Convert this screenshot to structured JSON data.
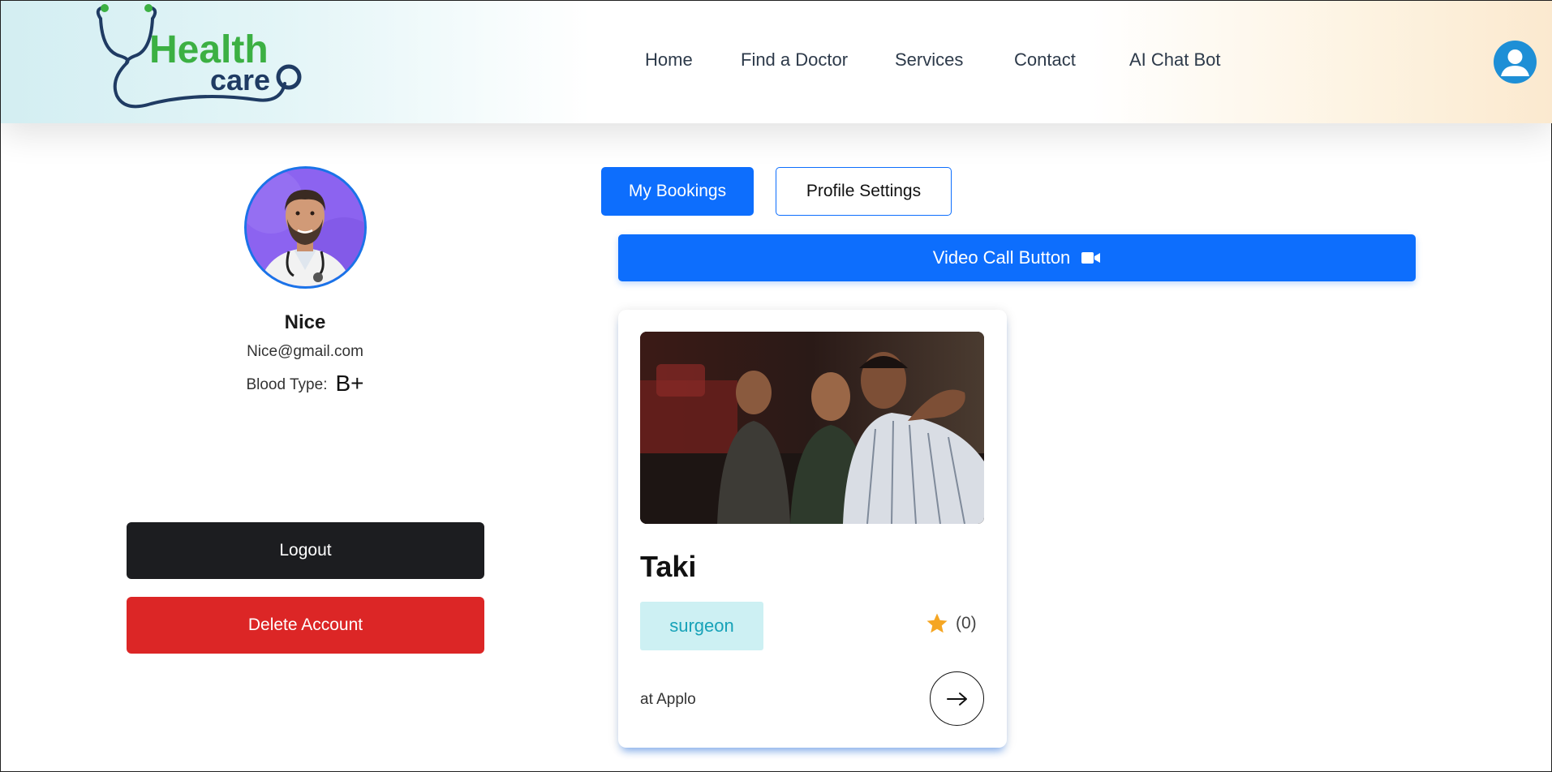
{
  "header": {
    "logo_text_top": "Health",
    "logo_text_bottom": "care",
    "nav": [
      {
        "label": "Home"
      },
      {
        "label": "Find a Doctor"
      },
      {
        "label": "Services"
      },
      {
        "label": "Contact"
      },
      {
        "label": "AI Chat Bot"
      }
    ],
    "account_icon": "user-circle-icon"
  },
  "profile": {
    "name": "Nice",
    "email": "Nice@gmail.com",
    "blood_type_label": "Blood Type:",
    "blood_type_value": "B+",
    "photo_icon": "doctor-avatar"
  },
  "actions": {
    "logout_label": "Logout",
    "delete_label": "Delete Account"
  },
  "tabs": {
    "bookings_label": "My Bookings",
    "settings_label": "Profile Settings"
  },
  "video_call": {
    "label": "Video Call Button",
    "icon": "video-camera-icon"
  },
  "booking_card": {
    "doctor_name": "Taki",
    "specialty": "surgeon",
    "rating_count": "(0)",
    "hospital": "at Applo",
    "icons": [
      "star-icon",
      "arrow-right-icon"
    ]
  },
  "colors": {
    "primary": "#0d6efd",
    "danger": "#dc2626",
    "dark": "#1c1d20",
    "badge_bg": "#cdf0f3",
    "badge_text": "#17a2b8",
    "logo_green": "#3cb043",
    "logo_navy": "#1f3b63",
    "star": "#f5a623"
  }
}
